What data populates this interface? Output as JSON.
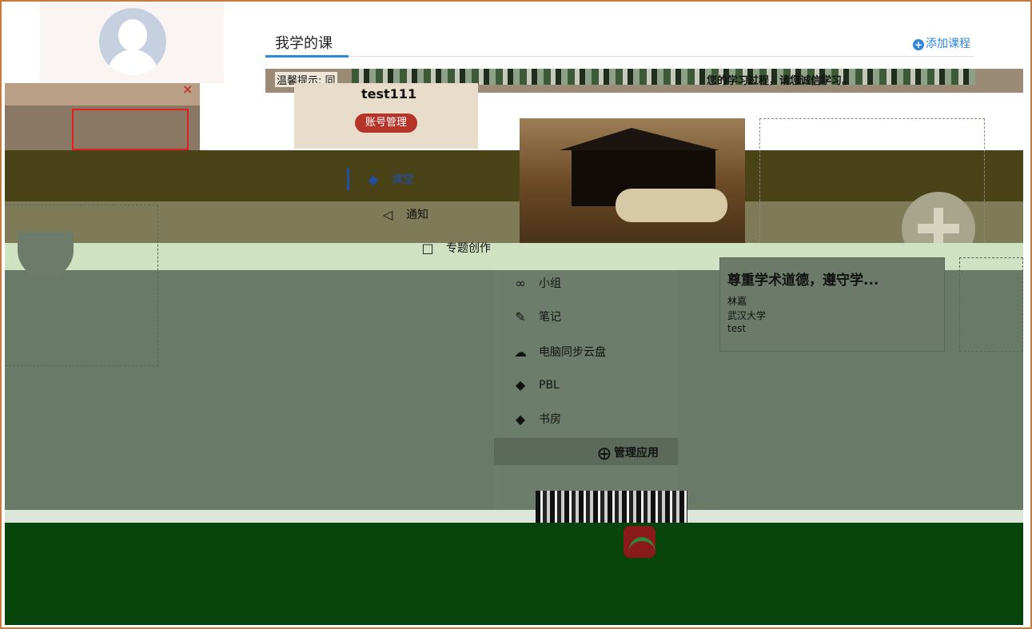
{
  "profile": {
    "username": "test111",
    "account_button": "账号管理",
    "close_label": "×"
  },
  "course": {
    "section_title": "我学的课",
    "add_course": "添加课程",
    "notice_prefix": "温馨提示: 同",
    "notice_suffix": "您的学习过程，请您诚信学习。",
    "card": {
      "name": "尊重学术道德，遵守学...",
      "teacher": "林嘉",
      "school": "武汉大学",
      "extra": "test"
    }
  },
  "menu": {
    "items": [
      {
        "label": "课堂",
        "icon": "graduation-cap-icon"
      },
      {
        "label": "通知",
        "icon": "megaphone-icon"
      },
      {
        "label": "专题创作",
        "icon": "window-icon"
      },
      {
        "label": "小组",
        "icon": "group-icon"
      },
      {
        "label": "笔记",
        "icon": "note-icon"
      },
      {
        "label": "电脑同步云盘",
        "icon": "cloud-icon"
      },
      {
        "label": "PBL",
        "icon": "graduation-cap-icon"
      },
      {
        "label": "书房",
        "icon": "graduation-cap-icon"
      }
    ],
    "manage_apps": "管理应用"
  },
  "footer": {
    "qr_label": "..."
  },
  "colors": {
    "accent": "#2e86de",
    "account_button": "#b5352b",
    "frame": "#c9793a"
  }
}
